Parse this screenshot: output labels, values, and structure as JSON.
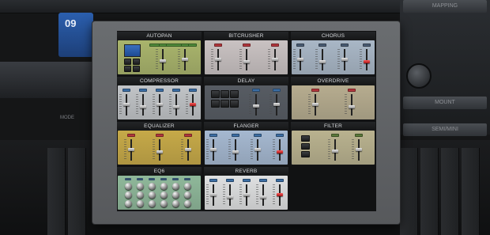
{
  "background_app": {
    "pad_number": "09",
    "side_text": "MODE",
    "right_buttons": [
      "MAPPING",
      "",
      "MOUNT",
      "SEMI/MINI"
    ]
  },
  "effects": [
    {
      "id": "autopan",
      "label": "AUTOPAN",
      "bg": "#a9b46c",
      "lamp": "#4f8a3a",
      "layout": "autopan",
      "sliders": 2
    },
    {
      "id": "bitcrusher",
      "label": "BITCRUSHER",
      "bg": "#c9c2c2",
      "lamp": "#b2373c",
      "layout": "sliders",
      "sliders": 3,
      "red_cap": []
    },
    {
      "id": "chorus",
      "label": "CHORUS",
      "bg": "#a9b7c6",
      "lamp": "#4a5d74",
      "layout": "sliders",
      "sliders": 4,
      "red_cap": [
        3
      ]
    },
    {
      "id": "compressor",
      "label": "COMPRESSOR",
      "bg": "#c1c4c7",
      "lamp": "#3c6ea4",
      "layout": "sliders",
      "sliders": 5,
      "red_cap": [
        4
      ]
    },
    {
      "id": "delay",
      "label": "DELAY",
      "bg": "#575c63",
      "lamp": "#3c6ea4",
      "layout": "delay",
      "sliders": 2,
      "red_cap": []
    },
    {
      "id": "overdrive",
      "label": "OVERDRIVE",
      "bg": "#b6ac8f",
      "lamp": "#b2373c",
      "layout": "sliders",
      "sliders": 2,
      "red_cap": []
    },
    {
      "id": "equalizer",
      "label": "EQUALIZER",
      "bg": "#c6a948",
      "lamp": "#b2373c",
      "layout": "sliders",
      "sliders": 3,
      "red_cap": []
    },
    {
      "id": "flanger",
      "label": "FLANGER",
      "bg": "#a5b8d0",
      "lamp": "#3c6ea4",
      "layout": "sliders",
      "sliders": 4,
      "red_cap": [
        3
      ]
    },
    {
      "id": "filter",
      "label": "FILTER",
      "bg": "#b9b28f",
      "lamp": "#5b7a3a",
      "layout": "filter",
      "sliders": 2,
      "red_cap": []
    },
    {
      "id": "eq6",
      "label": "EQ6",
      "bg": "#8fb89a",
      "lamp": "#34506d",
      "layout": "knobs",
      "sliders": 0,
      "red_cap": []
    },
    {
      "id": "reverb",
      "label": "REVERB",
      "bg": "#dfe0e1",
      "lamp": "#3c6ea4",
      "layout": "sliders",
      "sliders": 5,
      "red_cap": [
        4
      ]
    }
  ]
}
